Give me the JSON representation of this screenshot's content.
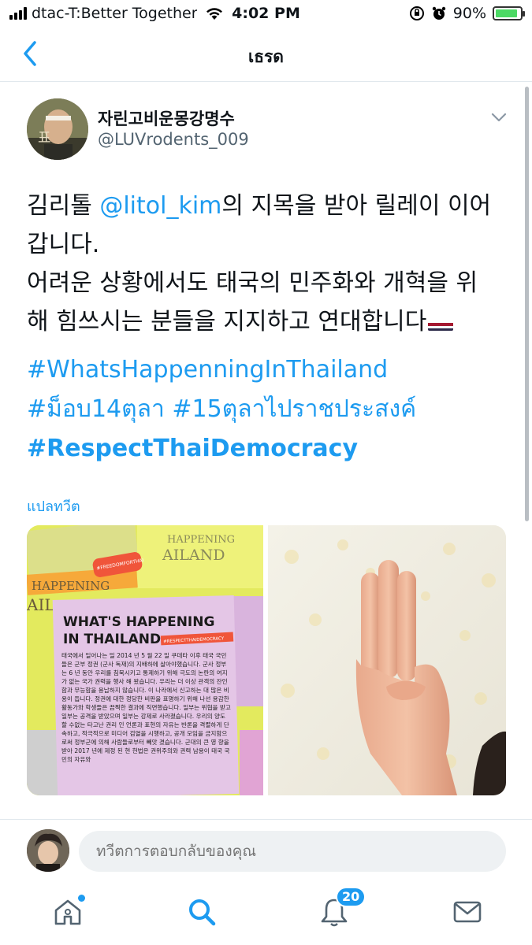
{
  "status_bar": {
    "carrier": "dtac-T:Better Together",
    "time": "4:02 PM",
    "battery_percent": "90%",
    "battery_level": 0.9,
    "icons": [
      "signal-icon",
      "wifi-icon",
      "orientation-lock-icon",
      "alarm-icon",
      "battery-icon"
    ]
  },
  "header": {
    "title": "เธรด",
    "back_icon": "chevron-left-icon"
  },
  "tweet": {
    "author_name": "자린고비운몽강명수",
    "author_handle": "@LUVrodents_009",
    "text_line1_a": "김리톨 ",
    "mention": "@litol_kim",
    "text_line1_b": "의 지목을 받아 릴레이 이어",
    "text_line2": "갑니다.",
    "text_line3": "어려운 상황에서도 태국의 민주화와 개혁을 위",
    "text_line4": "해 힘쓰시는 분들을 지지하고 연대합니다",
    "flag": "thailand-flag-emoji",
    "hashtags": {
      "h1": "#WhatsHappenningInThailand",
      "h2": "#ม็อบ14ตุลา",
      "h3": "#15ตุลาไปราชประสงค์",
      "h4": "#RespectThaiDemocracy"
    },
    "translate_label": "แปลทวีต",
    "media": {
      "poster": {
        "heading_line1": "WHAT'S HAPPENING",
        "heading_line2": "IN THAILAND",
        "tag": "#RESPECTTHAIDEMOCRACY",
        "body": "태국에서 일어나는 일 2014 년 5 월 22 일 쿠데타 이후 태국 국민들은 군부 정권 (군사 독재)의 지배하에 살아야했습니다. 군사 정부는 6 년 동안 우리를 침묵시키고 통제하기 위해 극도의 논란의 여지가 없는 국가 권력을 행사 해 왔습니다. 우리는 더 이상 관객의 잔인 함과 무능함을 용납하지 않습니다. 이 나라에서 신고하는 대 많은 비용이 듭니다. 정권에 대한 정당한 비판을 표명하기 위해 나선 용감한 활동가와 학생들은 끔찍한 결과에 직면했습니다. 일부는 위협을 받고 일부는 공격을 받았으며 일부는 강제로 사라졌습니다. 우리의 양도 할 수없는 타고난 권리 인 언론과 표현의 자유는 반론을 격렬하게 단속하고, 적극적으로 미디어 검열을 시행하고, 공개 모임을 금지함으로써 정부군에 의해 사람들로부터 빼앗 겼습니다. 군대의 큰 영 향을 받아 2017 년에 제정 된 현 헌법은 권위주의와 권력 남용이 태국 국민의 자유와",
        "bg_words_1": "HAPPENING",
        "bg_words_2": "AIL",
        "bg_words_3": "HAPPENING",
        "bg_words_4": "AILAND",
        "badge": "#FREEDOMFORTHAI"
      },
      "photo": "three-finger-salute-photo"
    }
  },
  "reply": {
    "placeholder": "ทวีตการตอบกลับของคุณ"
  },
  "tab_bar": {
    "notifications_badge": "20",
    "tabs": [
      "home-icon",
      "search-icon",
      "notifications-icon",
      "messages-icon"
    ]
  },
  "colors": {
    "accent": "#1d9bf0",
    "text": "#0f1419",
    "muted": "#536471",
    "poster_bg": "#e8f06a",
    "poster_card": "#e4c6e6",
    "poster_tag": "#f0553a"
  }
}
